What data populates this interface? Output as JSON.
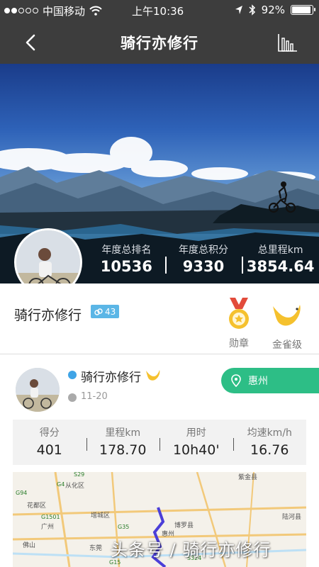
{
  "status_bar": {
    "carrier": "中国移动",
    "time": "上午10:36",
    "battery": "92%",
    "battery_level": 0.92,
    "signal_bars": 2,
    "signal_total": 5
  },
  "nav": {
    "title": "骑行亦修行",
    "back_icon": "chevron-left-icon",
    "chart_icon": "bar-chart-icon"
  },
  "hero": {
    "stats": [
      {
        "label": "年度总排名",
        "value": "10536"
      },
      {
        "label": "年度总积分",
        "value": "9330"
      },
      {
        "label": "总里程km",
        "value": "3854.64"
      }
    ]
  },
  "profile": {
    "name": "骑行亦修行",
    "level": "43",
    "medal_label": "勋章",
    "rank_label": "金雀级"
  },
  "activity": {
    "name": "骑行亦修行",
    "date": "11-20",
    "location": "惠州",
    "metrics": [
      {
        "label": "得分",
        "value": "401"
      },
      {
        "label": "里程km",
        "value": "178.70"
      },
      {
        "label": "用时",
        "value": "10h40'"
      },
      {
        "label": "均速km/h",
        "value": "16.76"
      }
    ],
    "map_labels": [
      "紫金县",
      "从化区",
      "花都区",
      "广州",
      "增城区",
      "佛山",
      "东莞",
      "惠州",
      "博罗县",
      "陆河县"
    ],
    "map_road_labels": [
      "S29",
      "G4",
      "G94",
      "G1501",
      "G35",
      "S324",
      "G15"
    ]
  },
  "watermark": "头条号 / 骑行亦修行",
  "colors": {
    "nav_bg": "#3d3d3d",
    "accent_green": "#2dbe86",
    "badge_blue": "#5bb6e6",
    "gold": "#f5c12e"
  }
}
